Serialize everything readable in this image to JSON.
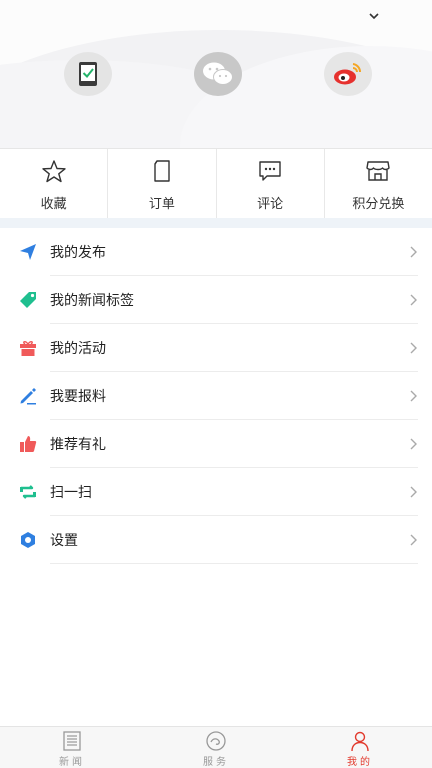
{
  "header": {
    "dropdown_icon": "chevron-down-icon",
    "social": [
      {
        "name": "tablet-login",
        "icon": "tablet-check-icon"
      },
      {
        "name": "wechat-login",
        "icon": "wechat-icon"
      },
      {
        "name": "weibo-login",
        "icon": "weibo-icon"
      }
    ]
  },
  "quick_actions": [
    {
      "label": "收藏",
      "icon": "star-icon"
    },
    {
      "label": "订单",
      "icon": "order-icon"
    },
    {
      "label": "评论",
      "icon": "comment-icon"
    },
    {
      "label": "积分兑换",
      "icon": "store-icon"
    }
  ],
  "menu": [
    {
      "label": "我的发布",
      "icon": "send-icon",
      "color": "#2f7fe0"
    },
    {
      "label": "我的新闻标签",
      "icon": "tag-icon",
      "color": "#1fbf8f"
    },
    {
      "label": "我的活动",
      "icon": "gift-icon",
      "color": "#f05a5a"
    },
    {
      "label": "我要报料",
      "icon": "pen-icon",
      "color": "#2f7fe0"
    },
    {
      "label": "推荐有礼",
      "icon": "thumbs-up-icon",
      "color": "#f05a5a"
    },
    {
      "label": "扫一扫",
      "icon": "scan-icon",
      "color": "#1fbf8f"
    },
    {
      "label": "设置",
      "icon": "settings-icon",
      "color": "#2f7fe0"
    }
  ],
  "tabbar": [
    {
      "label": "新闻",
      "icon": "newspaper-icon",
      "active": false
    },
    {
      "label": "服务",
      "icon": "service-icon",
      "active": false
    },
    {
      "label": "我的",
      "icon": "person-icon",
      "active": true
    }
  ],
  "colors": {
    "accent_active": "#e23a2d",
    "separator": "#eef3f8"
  }
}
